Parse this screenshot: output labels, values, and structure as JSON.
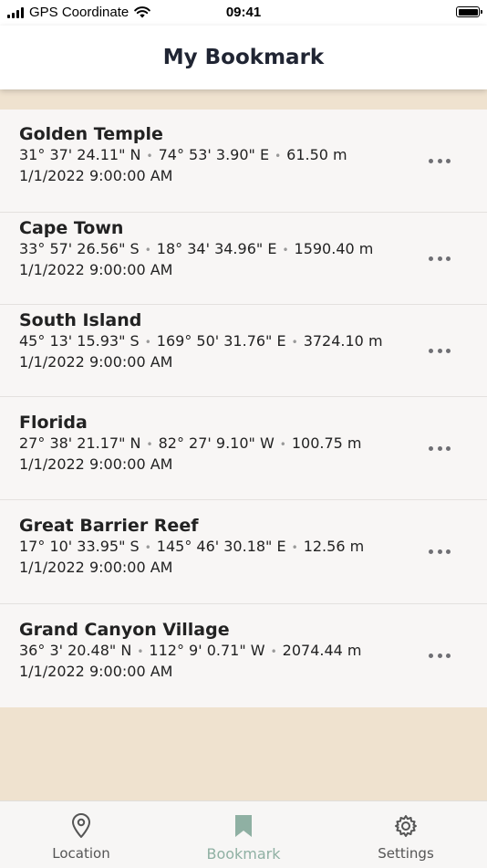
{
  "status_bar": {
    "carrier": "GPS Coordinate",
    "time": "09:41"
  },
  "header": {
    "title": "My Bookmark"
  },
  "bookmarks": [
    {
      "name": "Golden Temple",
      "lat": "31° 37' 24.11\" N",
      "lon": "74° 53' 3.90\" E",
      "alt": "61.50 m",
      "date": "1/1/2022 9:00:00 AM"
    },
    {
      "name": "Cape Town",
      "lat": "33° 57' 26.56\" S",
      "lon": "18° 34' 34.96\" E",
      "alt": "1590.40 m",
      "date": "1/1/2022 9:00:00 AM"
    },
    {
      "name": "South Island",
      "lat": "45° 13' 15.93\" S",
      "lon": "169° 50' 31.76\" E",
      "alt": "3724.10 m",
      "date": "1/1/2022 9:00:00 AM"
    },
    {
      "name": "Florida",
      "lat": "27° 38' 21.17\" N",
      "lon": "82° 27' 9.10\" W",
      "alt": "100.75 m",
      "date": "1/1/2022 9:00:00 AM"
    },
    {
      "name": "Great Barrier Reef",
      "lat": "17° 10' 33.95\" S",
      "lon": "145° 46' 30.18\" E",
      "alt": "12.56 m",
      "date": "1/1/2022 9:00:00 AM"
    },
    {
      "name": "Grand Canyon Village",
      "lat": "36° 3' 20.48\" N",
      "lon": "112° 9' 0.71\" W",
      "alt": "2074.44 m",
      "date": "1/1/2022 9:00:00 AM"
    }
  ],
  "tab_bar": {
    "tabs": [
      {
        "label": "Location",
        "icon": "map-pin-icon"
      },
      {
        "label": "Bookmark",
        "icon": "bookmark-icon",
        "active": true
      },
      {
        "label": "Settings",
        "icon": "gear-icon"
      }
    ]
  },
  "colors": {
    "background": "#efe2cf",
    "list_background": "#f8f6f5",
    "accent": "#8fb0a3",
    "more_dots": "#6f6f74"
  }
}
